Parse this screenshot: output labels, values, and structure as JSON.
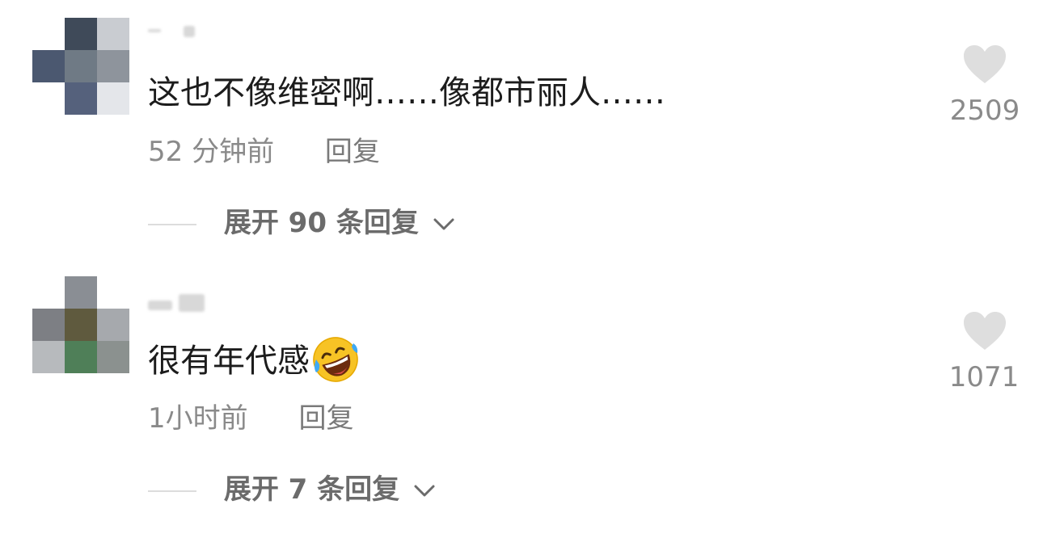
{
  "comments": [
    {
      "text": "这也不像维密啊……像都市丽人……",
      "time": "52 分钟前",
      "reply_label": "回复",
      "expand_label": "展开 90 条回复",
      "like_count": "2509",
      "emoji": ""
    },
    {
      "text": "很有年代感",
      "time": "1小时前",
      "reply_label": "回复",
      "expand_label": "展开 7 条回复",
      "like_count": "1071",
      "emoji": "rolling-on-floor-laughing-emoji"
    }
  ],
  "colors": {
    "text": "#1c1c1c",
    "meta": "#8a8a8a",
    "expand": "#6b6b6b",
    "heart": "#dedede",
    "divider": "#dcdcdc"
  },
  "icons": {
    "like": "heart-icon",
    "expand": "chevron-down-icon"
  }
}
